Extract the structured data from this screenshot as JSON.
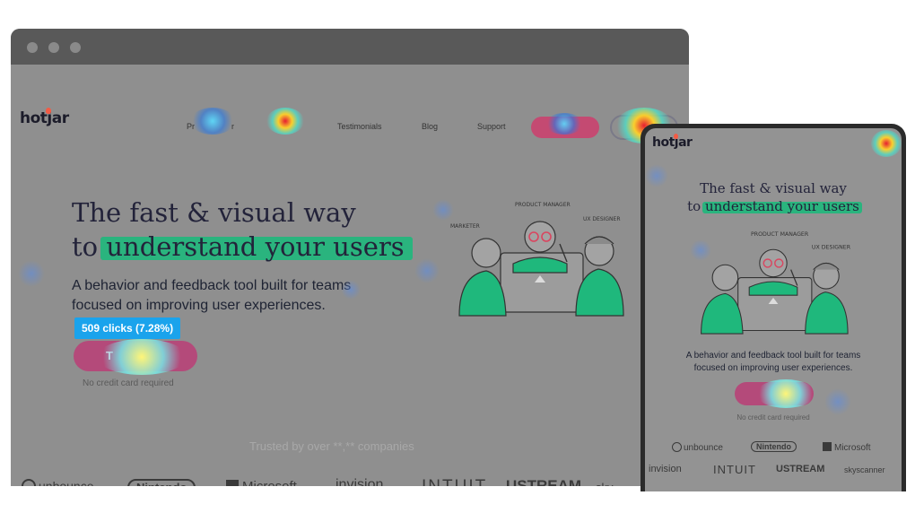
{
  "desktop": {
    "logo": "hotjar",
    "nav": [
      "Pr",
      "r",
      "Testimonials",
      "Blog",
      "Support"
    ],
    "hero": {
      "title_line1": "The fast & visual way",
      "title_line2_prefix": "to",
      "title_line2_highlight": "understand your users",
      "subtitle_line1": "A behavior and feedback tool built for teams",
      "subtitle_line2": "focused on improving user experiences."
    },
    "click_badge": "509 clicks (7.28%)",
    "cta_label": "T",
    "no_card_note": "No credit card required",
    "trusted": "Trusted by over **,** companies",
    "brands": [
      "unbounce",
      "Nintendo",
      "Microsoft",
      "invision",
      "INTUIT",
      "USTREAM",
      "sky"
    ]
  },
  "mobile": {
    "logo": "hotjar",
    "hero": {
      "title_line1": "The fast & visual way",
      "title_line2_prefix": "to",
      "title_line2_highlight": "understand your users",
      "subtitle_line1": "A behavior and feedback tool built for teams",
      "subtitle_line2": "focused on improving user experiences."
    },
    "no_card_note": "No credit card required",
    "brands_row1": [
      "unbounce",
      "Nintendo",
      "Microsoft"
    ],
    "brands_row2": [
      "invision",
      "INTUIT",
      "USTREAM",
      "skyscanner"
    ]
  },
  "illustration_labels": [
    "MARKETER",
    "PRODUCT MANAGER",
    "UX DESIGNER"
  ],
  "colors": {
    "brand_green": "#1fb87c",
    "badge_blue": "#1aa3ec",
    "cta_pink": "#b44a7a",
    "window_chrome": "#595959",
    "overlay_gray": "#8f8f8f"
  }
}
